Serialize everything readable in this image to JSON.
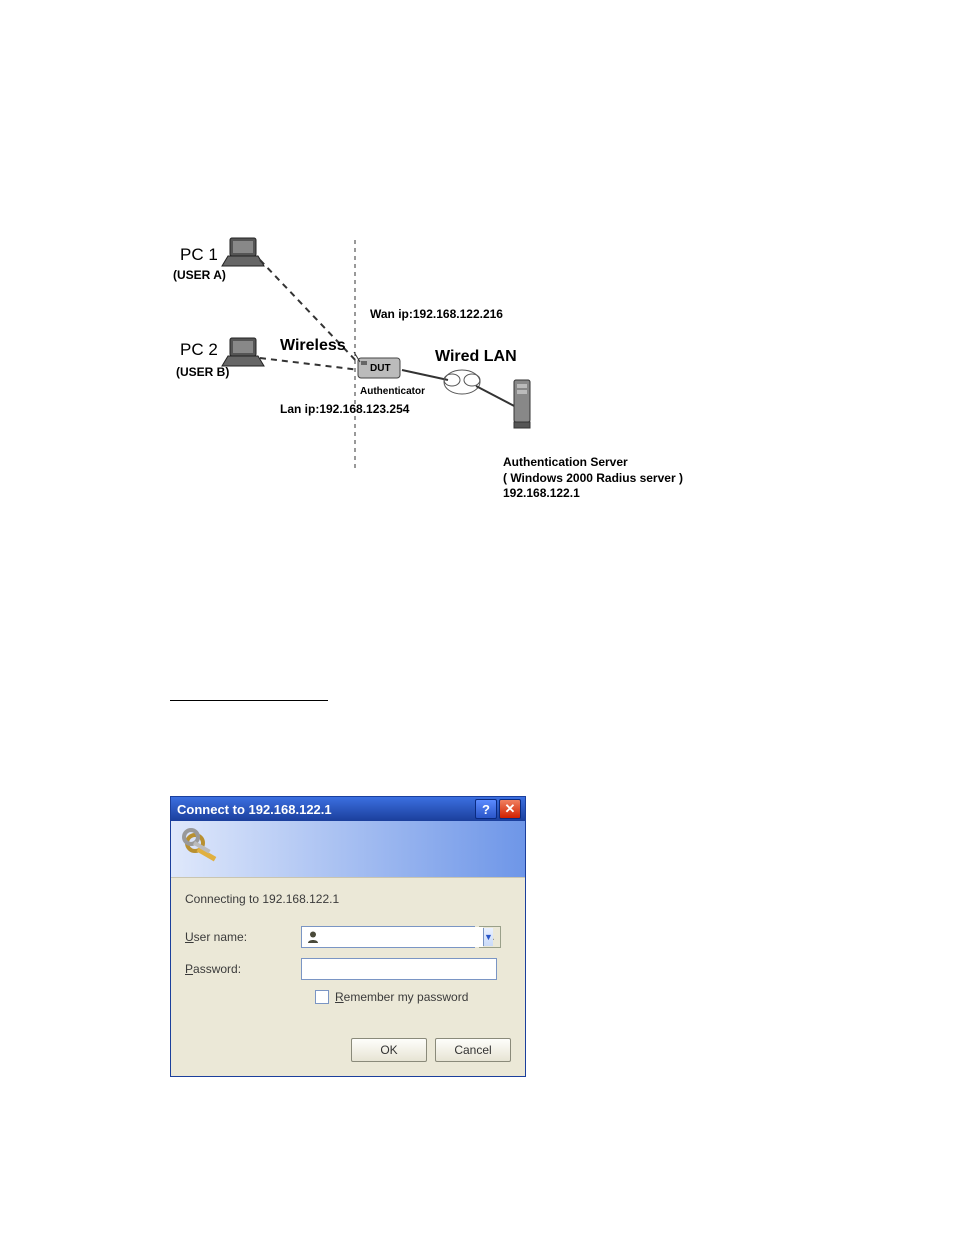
{
  "topology": {
    "pc1_label": "PC 1",
    "pc1_sub": "(USER A)",
    "pc2_label": "PC 2",
    "pc2_sub": "(USER B)",
    "wireless_label": "Wireless",
    "wan_ip_label": "Wan ip:192.168.122.216",
    "dut_label": "DUT",
    "authenticator_label": "Authenticator",
    "lan_ip_label": "Lan ip:192.168.123.254",
    "wired_label": "Wired  LAN",
    "auth_server_l1": "Authentication Server",
    "auth_server_l2": "( Windows 2000 Radius server )",
    "auth_server_ip": "192.168.122.1"
  },
  "dialog": {
    "title": "Connect to 192.168.122.1",
    "connecting": "Connecting to 192.168.122.1",
    "username_label_u": "U",
    "username_label_rest": "ser name:",
    "username_value": "",
    "password_label_u": "P",
    "password_label_rest": "assword:",
    "password_value": "",
    "remember_u": "R",
    "remember_rest": "emember my password",
    "ok_label": "OK",
    "cancel_label": "Cancel",
    "dots_label": "..."
  }
}
